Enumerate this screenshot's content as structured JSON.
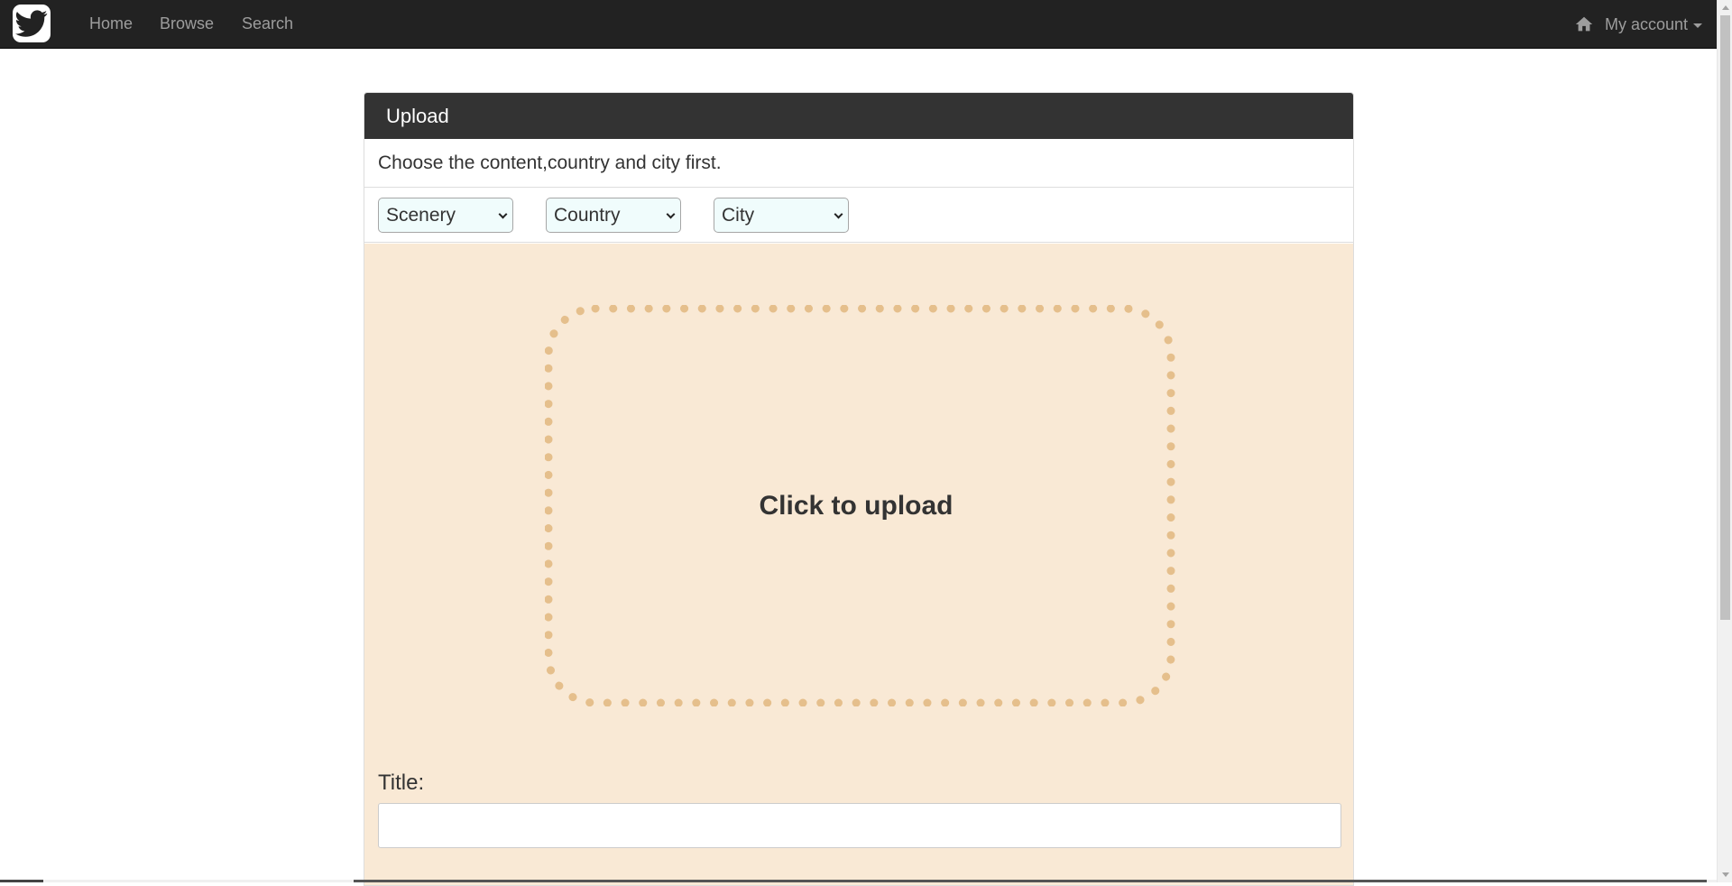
{
  "navbar": {
    "logo": "twitter-bird-icon",
    "links": [
      "Home",
      "Browse",
      "Search"
    ],
    "account_icon": "home-icon",
    "account_label": "My account"
  },
  "panel": {
    "heading": "Upload",
    "instruction": "Choose the content,country and city first.",
    "selects": {
      "content": "Scenery",
      "country": "Country",
      "city": "City"
    },
    "dropzone_label": "Click to upload",
    "title_label": "Title:",
    "title_value": ""
  },
  "colors": {
    "navbar_bg": "#222222",
    "panel_heading_bg": "#333333",
    "upload_bg": "#f9e9d5",
    "dotted_border": "#e5bf8c"
  }
}
